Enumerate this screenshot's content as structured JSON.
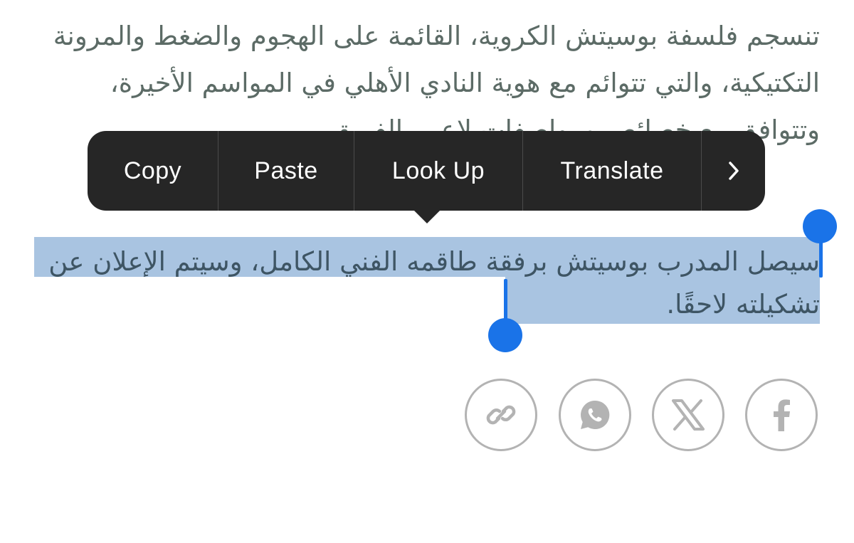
{
  "article": {
    "paragraph1": "تنسجم فلسفة بوسيتش الكروية، القائمة على الهجوم والضغط والمرونة التكتيكية، والتي تتوائم مع هوية النادي الأهلي في المواسم الأخيرة، وتتوافق مع خصائص ومواصفات لاعبي الفريق.",
    "paragraph2": "سيصل المدرب بوسيتش برفقة طاقمه الفني الكامل، وسيتم الإعلان عن تشكيلته لاحقًا."
  },
  "context_menu": {
    "items": [
      {
        "label": "Copy"
      },
      {
        "label": "Paste"
      },
      {
        "label": "Look Up"
      },
      {
        "label": "Translate"
      }
    ],
    "more_icon": "chevron-right-icon"
  },
  "share": {
    "buttons": [
      {
        "icon": "link-icon"
      },
      {
        "icon": "whatsapp-icon"
      },
      {
        "icon": "x-icon"
      },
      {
        "icon": "facebook-icon"
      }
    ],
    "icon_color": "#b3b3b3"
  },
  "colors": {
    "text": "#5c6b66",
    "selection": "#a9c4e1",
    "selection_handle": "#1a73e8",
    "menu_bg": "#262626"
  }
}
